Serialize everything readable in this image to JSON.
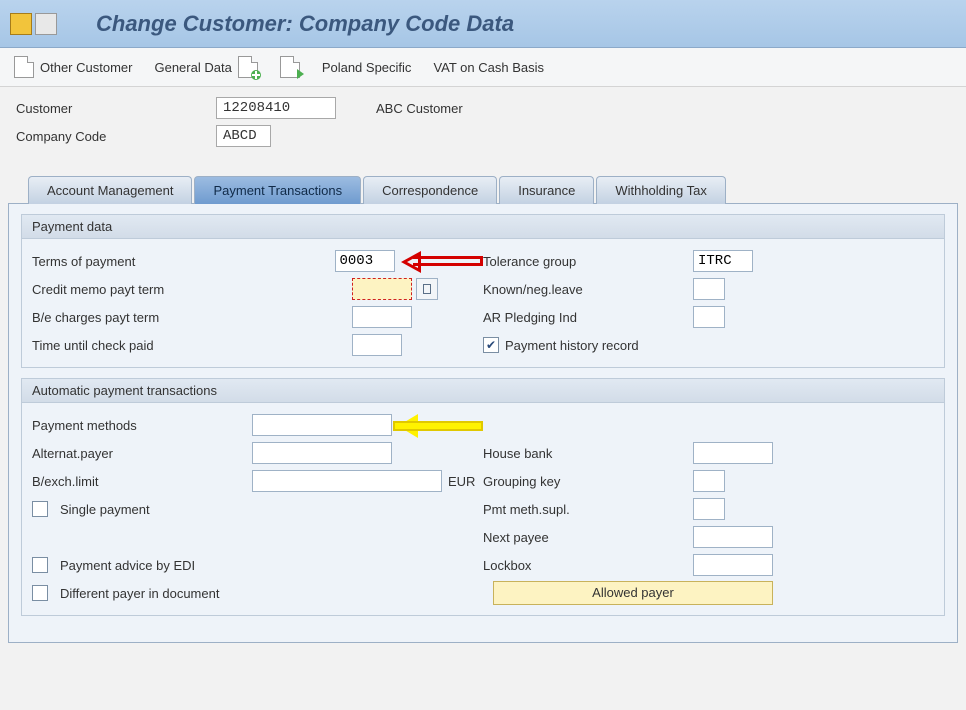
{
  "title": "Change Customer: Company Code Data",
  "appbar": {
    "other_customer": "Other Customer",
    "general_data": "General Data",
    "poland_specific": "Poland Specific",
    "vat_cash": "VAT on Cash Basis"
  },
  "header": {
    "customer_label": "Customer",
    "customer_value": "12208410",
    "customer_name": "ABC Customer",
    "company_code_label": "Company Code",
    "company_code_value": "ABCD"
  },
  "tabs": {
    "account": "Account Management",
    "payment": "Payment Transactions",
    "correspondence": "Correspondence",
    "insurance": "Insurance",
    "withholding": "Withholding Tax"
  },
  "group1": {
    "title": "Payment data",
    "terms_label": "Terms of payment",
    "terms_value": "0003",
    "tolerance_label": "Tolerance group",
    "tolerance_value": "ITRC",
    "credit_memo_label": "Credit memo payt term",
    "credit_memo_value": "",
    "known_neg_label": "Known/neg.leave",
    "known_neg_value": "",
    "be_charges_label": "B/e charges payt term",
    "be_charges_value": "",
    "ar_pledging_label": "AR Pledging Ind",
    "ar_pledging_value": "",
    "time_check_label": "Time until check paid",
    "time_check_value": "",
    "pay_history_label": "Payment history record"
  },
  "group2": {
    "title": "Automatic payment transactions",
    "pay_methods_label": "Payment methods",
    "pay_methods_value": "",
    "alt_payer_label": "Alternat.payer",
    "alt_payer_value": "",
    "house_bank_label": "House bank",
    "house_bank_value": "",
    "bexch_label": "B/exch.limit",
    "bexch_value": "",
    "bexch_unit": "EUR",
    "grouping_label": "Grouping key",
    "grouping_value": "",
    "single_payment_label": "Single payment",
    "pmt_meth_supl_label": "Pmt meth.supl.",
    "pmt_meth_supl_value": "",
    "next_payee_label": "Next payee",
    "next_payee_value": "",
    "pay_advice_label": "Payment advice by EDI",
    "lockbox_label": "Lockbox",
    "lockbox_value": "",
    "diff_payer_label": "Different payer in document",
    "allowed_payer": "Allowed payer"
  }
}
